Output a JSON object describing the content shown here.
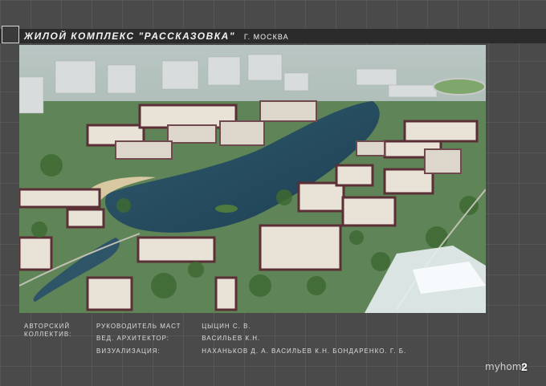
{
  "header": {
    "title": "ЖИЛОЙ КОМПЛЕКС \"РАССКАЗОВКА\"",
    "city": "Г. МОСКВА"
  },
  "credits": {
    "heading_line1": "АВТОРСКИЙ",
    "heading_line2": "КОЛЛЕКТИВ:",
    "rows": [
      {
        "role": "РУКОВОДИТЕЛЬ МАСТ",
        "names": "ЦЫЦИН С. В."
      },
      {
        "role": "ВЕД. АРХИТЕКТОР:",
        "names": "ВАСИЛЬЕВ К.Н."
      },
      {
        "role": "ВИЗУАЛИЗАЦИЯ:",
        "names": "НАХАНЬКОВ Д. А. ВАСИЛЬЕВ К.Н. БОНДАРЕНКО. Г. Б."
      }
    ]
  },
  "footer": {
    "logo": "myhome",
    "page_number": "2"
  }
}
